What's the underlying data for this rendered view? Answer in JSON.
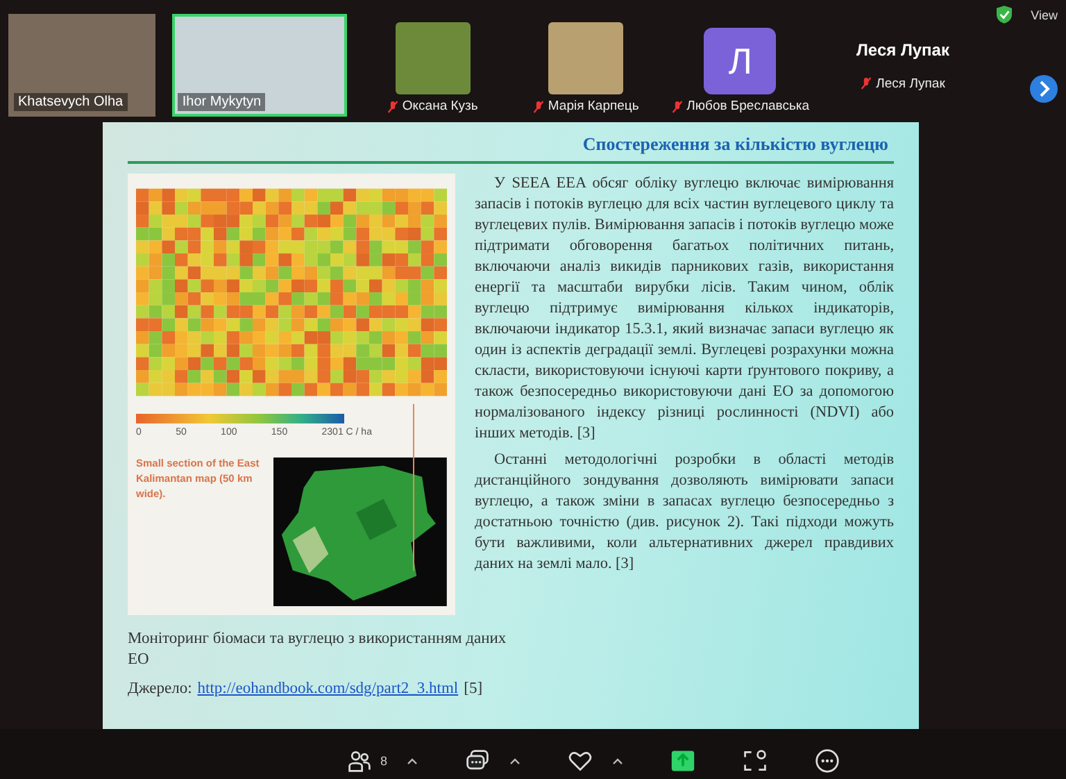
{
  "top_bar": {
    "view_label": "View"
  },
  "participants": [
    {
      "name": "Khatsevych Olha",
      "kind": "video",
      "muted": false,
      "selected": false
    },
    {
      "name": "Ihor Mykytyn",
      "kind": "video",
      "muted": false,
      "selected": true
    },
    {
      "name": "Оксана Кузь",
      "kind": "photo",
      "muted": true,
      "selected": false
    },
    {
      "name": "Марія Карпець",
      "kind": "photo",
      "muted": true,
      "selected": false
    },
    {
      "name": "Любов Бреславська",
      "kind": "avatar",
      "letter": "Л",
      "muted": true,
      "selected": false
    },
    {
      "name": "Леся Лупак",
      "kind": "name",
      "heading": "Леся Лупак",
      "muted": true,
      "selected": false
    }
  ],
  "slide": {
    "title": "Спостереження за кількістю вуглецю",
    "paragraphs": [
      "У SEEA EEA обсяг обліку вуглецю включає вимірювання запасів і потоків вуглецю для всіх частин вуглецевого циклу та вуглецевих пулів. Вимірювання запасів і потоків вуглецю може підтримати обговорення багатьох політичних питань, включаючи аналіз викидів парникових газів, використання енергії та масштаби вирубки лісів. Таким чином, облік вуглецю підтримує вимірювання кількох індикаторів, включаючи індикатор 15.3.1, який визначає запаси вуглецю як один із аспектів деградації землі. Вуглецеві розрахунки можна скласти, використовуючи існуючі карти ґрунтового покриву, а також безпосередньо використовуючи дані ЕО за допомогою нормалізованого індексу різниці рослинності (NDVI) або інших методів. [3]",
      "Останні методологічні розробки в області методів дистанційного зондування дозволяють вимірювати запаси вуглецю, а також зміни в запасах вуглецю безпосередньо з достатньою точністю (див. рисунок 2). Такі підходи можуть бути важливими, коли альтернативних джерел правдивих даних на землі мало. [3]"
    ],
    "figure": {
      "legend_ticks": [
        "0",
        "50",
        "100",
        "150",
        "2301 C / ha"
      ],
      "map_caption": "Small section of the East Kalimantan map (50 km wide)."
    },
    "caption": "Моніторинг біомаси та вуглецю з використанням даних ЕО",
    "source": {
      "label": "Джерело:",
      "link": "http://eohandbook.com/sdg/part2_3.html",
      "ref": "[5]"
    }
  },
  "toolbar": {
    "participants_count": "8"
  }
}
